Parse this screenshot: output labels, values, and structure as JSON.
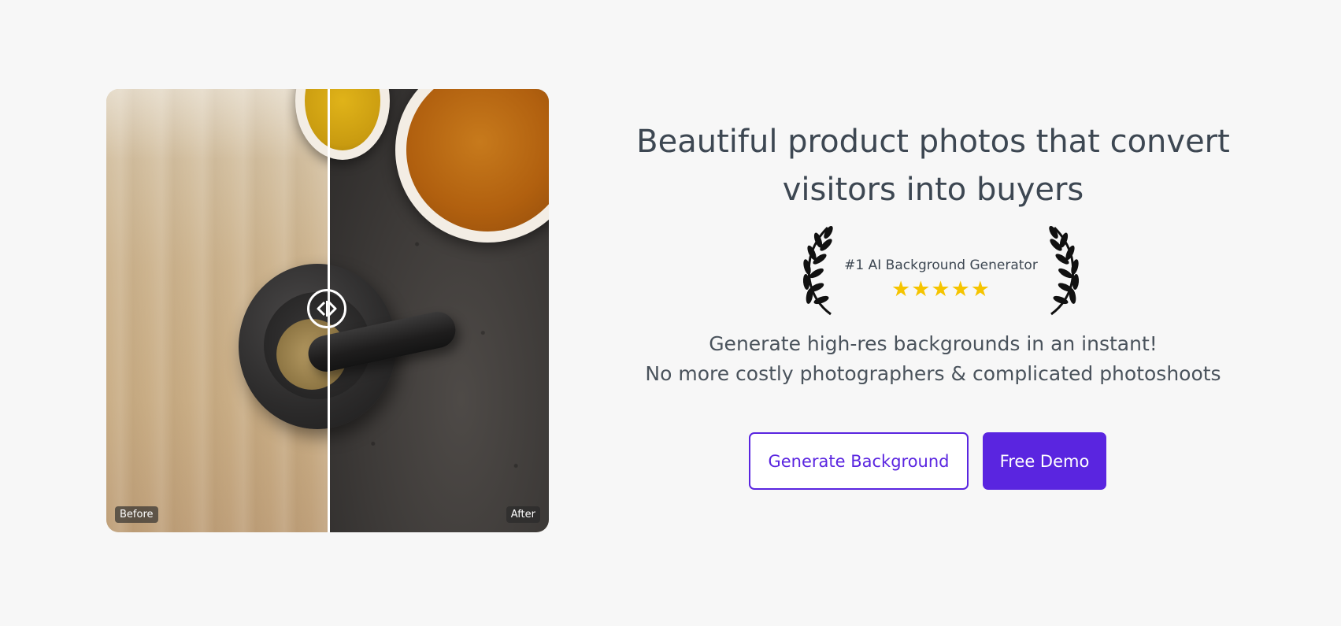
{
  "comparison": {
    "before_label": "Before",
    "after_label": "After",
    "handle_icon": "arrows-left-right-icon"
  },
  "hero": {
    "headline": "Beautiful product photos that convert visitors into buyers",
    "award": {
      "text": "#1 AI Background Generator",
      "stars": "★★★★★",
      "rating": 5,
      "laurel_icon": "laurel-wreath-icon"
    },
    "subline_1": "Generate high-res backgrounds in an instant!",
    "subline_2": "No more costly photographers & complicated photoshoots"
  },
  "buttons": {
    "generate_label": "Generate Background",
    "demo_label": "Free Demo"
  },
  "colors": {
    "accent": "#5a25e0",
    "text": "#3d4752",
    "background": "#f7f7f7",
    "star": "#f5c400"
  }
}
